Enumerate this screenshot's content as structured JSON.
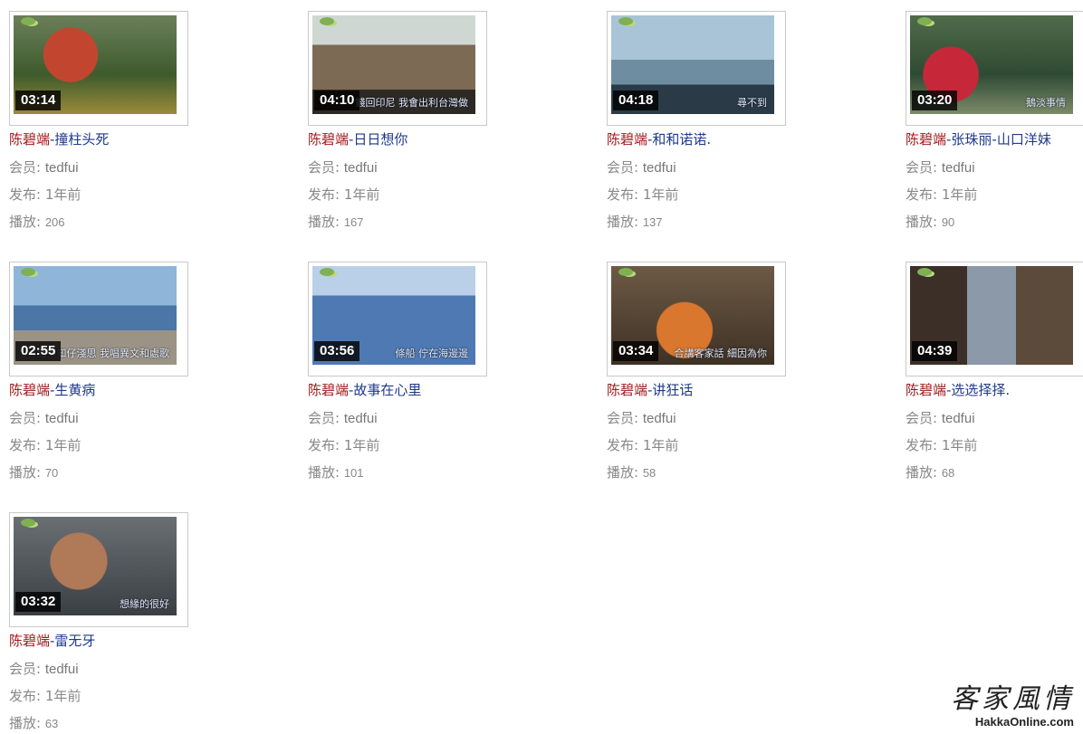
{
  "labels": {
    "member": "会员: ",
    "published": "发布: ",
    "plays": "播放: "
  },
  "videos": [
    {
      "artist": "陈碧端",
      "title": "-撞柱头死",
      "duration": "03:14",
      "member": "tedfui",
      "published": "1年前",
      "plays": "206",
      "subtitle": ""
    },
    {
      "artist": "陈碧端",
      "title": "-日日想你",
      "duration": "04:10",
      "member": "tedfui",
      "published": "1年前",
      "plays": "167",
      "subtitle": "錢回印尼 我會出利台灣做"
    },
    {
      "artist": "陈碧端",
      "title": "-和和诺诺.",
      "duration": "04:18",
      "member": "tedfui",
      "published": "1年前",
      "plays": "137",
      "subtitle": "尋不到"
    },
    {
      "artist": "陈碧端",
      "title": "-张珠丽-山口洋妹",
      "duration": "03:20",
      "member": "tedfui",
      "published": "1年前",
      "plays": "90",
      "subtitle": "鵝淡事情"
    },
    {
      "artist": "陈碧端",
      "title": "-生黄病",
      "duration": "02:55",
      "member": "tedfui",
      "published": "1年前",
      "plays": "70",
      "subtitle": "話不知仔淺思 我唱異文和處歌"
    },
    {
      "artist": "陈碧端",
      "title": "-故事在心里",
      "duration": "03:56",
      "member": "tedfui",
      "published": "1年前",
      "plays": "101",
      "subtitle": "條船 佇在海邊邊"
    },
    {
      "artist": "陈碧端",
      "title": "-讲狂话",
      "duration": "03:34",
      "member": "tedfui",
      "published": "1年前",
      "plays": "58",
      "subtitle": "合講客家話 細因為你"
    },
    {
      "artist": "陈碧端",
      "title": "-选选择择.",
      "duration": "04:39",
      "member": "tedfui",
      "published": "1年前",
      "plays": "68",
      "subtitle": ""
    },
    {
      "artist": "陈碧端",
      "title": "-雷无牙",
      "duration": "03:32",
      "member": "tedfui",
      "published": "1年前",
      "plays": "63",
      "subtitle": "想緣的很好"
    }
  ],
  "watermark": {
    "cn": "客家風情",
    "en": "HakkaOnline.com"
  }
}
